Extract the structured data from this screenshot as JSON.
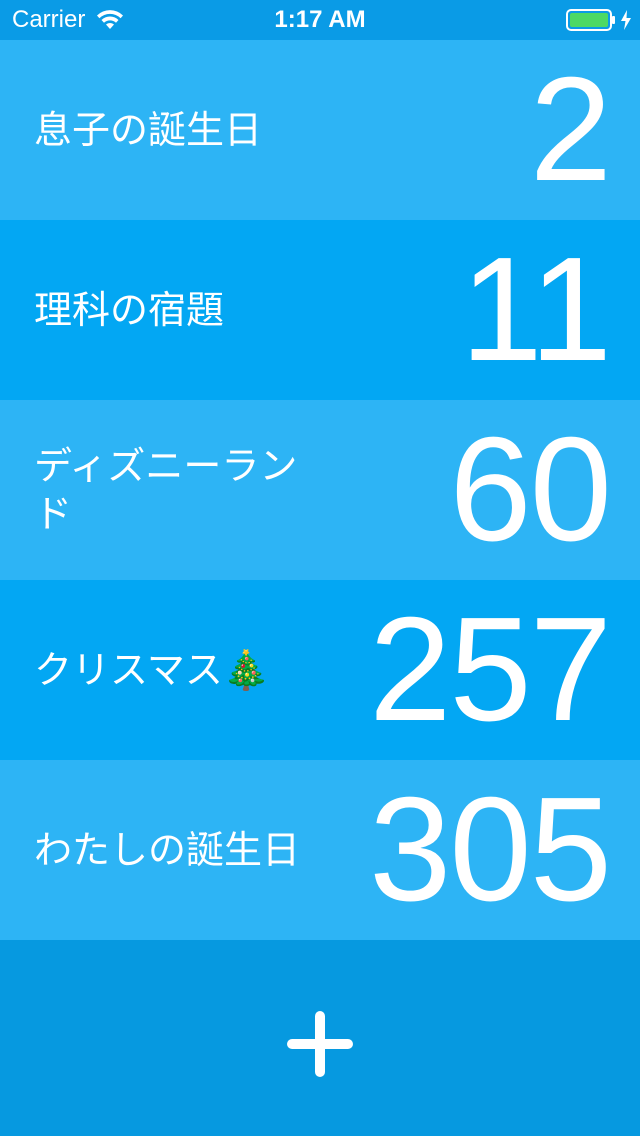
{
  "status_bar": {
    "carrier": "Carrier",
    "time": "1:17 AM",
    "signal_icon": "wifi-icon",
    "battery_icon": "battery-icon",
    "battery_color": "#4cd964",
    "charging_icon": "bolt-icon"
  },
  "countdowns": [
    {
      "title": "息子の誕生日",
      "days": "2"
    },
    {
      "title": "理科の宿題",
      "days": "11"
    },
    {
      "title": "ディズニーランド",
      "days": "60"
    },
    {
      "title": "クリスマス🎄",
      "days": "257"
    },
    {
      "title": "わたしの誕生日",
      "days": "305"
    }
  ],
  "add_button": {
    "icon": "plus-icon"
  },
  "colors": {
    "row_light": "#2db4f5",
    "row_dark": "#03a7f3",
    "footer": "#0699e0",
    "text": "#ffffff"
  }
}
